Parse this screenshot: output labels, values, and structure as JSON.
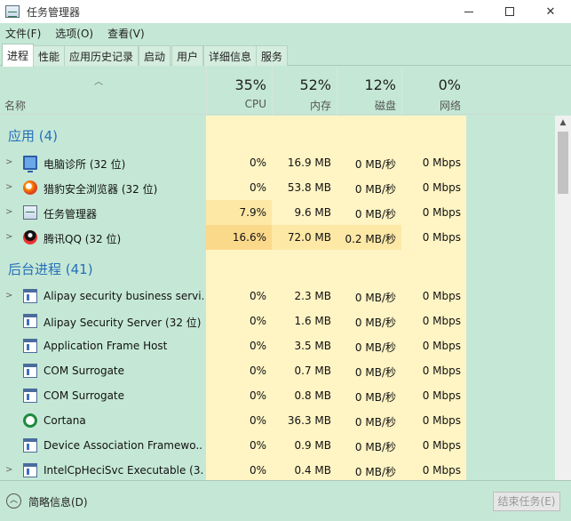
{
  "window": {
    "title": "任务管理器"
  },
  "menu": [
    {
      "label": "文件(F)"
    },
    {
      "label": "选项(O)"
    },
    {
      "label": "查看(V)"
    }
  ],
  "tabs": [
    {
      "label": "进程",
      "active": true
    },
    {
      "label": "性能"
    },
    {
      "label": "应用历史记录"
    },
    {
      "label": "启动"
    },
    {
      "label": "用户"
    },
    {
      "label": "详细信息"
    },
    {
      "label": "服务"
    }
  ],
  "header": {
    "name_label": "名称",
    "columns": [
      {
        "pct": "35%",
        "label": "CPU"
      },
      {
        "pct": "52%",
        "label": "内存"
      },
      {
        "pct": "12%",
        "label": "磁盘"
      },
      {
        "pct": "0%",
        "label": "网络"
      }
    ]
  },
  "groups": [
    {
      "title": "应用 (4)",
      "rows": [
        {
          "name": "电脑诊所 (32 位)",
          "icon": "monitor-icon",
          "expandable": true,
          "cpu": "0%",
          "mem": "16.9 MB",
          "disk": "0 MB/秒",
          "net": "0 Mbps"
        },
        {
          "name": "猎豹安全浏览器 (32 位)",
          "icon": "browser-icon",
          "expandable": true,
          "cpu": "0%",
          "mem": "53.8 MB",
          "disk": "0 MB/秒",
          "net": "0 Mbps"
        },
        {
          "name": "任务管理器",
          "icon": "task-manager-icon",
          "expandable": true,
          "cpu": "7.9%",
          "mem": "9.6 MB",
          "disk": "0 MB/秒",
          "net": "0 Mbps"
        },
        {
          "name": "腾讯QQ (32 位)",
          "icon": "qq-icon",
          "expandable": true,
          "cpu": "16.6%",
          "mem": "72.0 MB",
          "disk": "0.2 MB/秒",
          "net": "0 Mbps"
        }
      ]
    },
    {
      "title": "后台进程 (41)",
      "rows": [
        {
          "name": "Alipay security business servi...",
          "icon": "service-icon",
          "expandable": true,
          "cpu": "0%",
          "mem": "2.3 MB",
          "disk": "0 MB/秒",
          "net": "0 Mbps"
        },
        {
          "name": "Alipay Security Server (32 位)",
          "icon": "service-icon",
          "expandable": false,
          "cpu": "0%",
          "mem": "1.6 MB",
          "disk": "0 MB/秒",
          "net": "0 Mbps"
        },
        {
          "name": "Application Frame Host",
          "icon": "service-icon",
          "expandable": false,
          "cpu": "0%",
          "mem": "3.5 MB",
          "disk": "0 MB/秒",
          "net": "0 Mbps"
        },
        {
          "name": "COM Surrogate",
          "icon": "service-icon",
          "expandable": false,
          "cpu": "0%",
          "mem": "0.7 MB",
          "disk": "0 MB/秒",
          "net": "0 Mbps"
        },
        {
          "name": "COM Surrogate",
          "icon": "service-icon",
          "expandable": false,
          "cpu": "0%",
          "mem": "0.8 MB",
          "disk": "0 MB/秒",
          "net": "0 Mbps"
        },
        {
          "name": "Cortana",
          "icon": "cortana-icon",
          "expandable": false,
          "cpu": "0%",
          "mem": "36.3 MB",
          "disk": "0 MB/秒",
          "net": "0 Mbps"
        },
        {
          "name": "Device Association Framewo...",
          "icon": "service-icon",
          "expandable": false,
          "cpu": "0%",
          "mem": "0.9 MB",
          "disk": "0 MB/秒",
          "net": "0 Mbps"
        },
        {
          "name": "IntelCpHeciSvc Executable (3...",
          "icon": "service-icon",
          "expandable": true,
          "cpu": "0%",
          "mem": "0.4 MB",
          "disk": "0 MB/秒",
          "net": "0 Mbps"
        }
      ]
    }
  ],
  "footer": {
    "collapse_label": "简略信息(D)",
    "end_task_label": "结束任务(E)"
  }
}
